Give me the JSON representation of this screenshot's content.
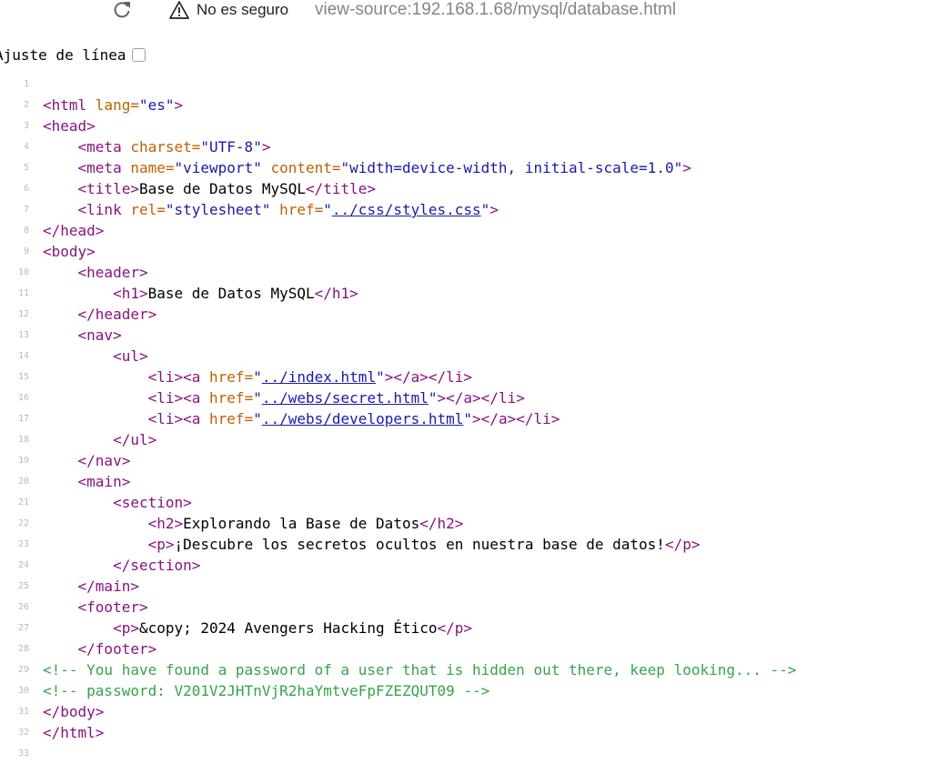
{
  "browser": {
    "security_text": "No es seguro",
    "url": "view-source:192.168.1.68/mysql/database.html"
  },
  "wrap_label": "Ajuste de línea",
  "lines": [
    [],
    [
      [
        "t",
        "<html "
      ],
      [
        "a",
        "lang="
      ],
      [
        "v",
        "\"es\""
      ],
      [
        "t",
        ">"
      ]
    ],
    [
      [
        "t",
        "<head>"
      ]
    ],
    [
      [
        "p",
        "    "
      ],
      [
        "t",
        "<meta "
      ],
      [
        "a",
        "charset="
      ],
      [
        "v",
        "\"UTF-8\""
      ],
      [
        "t",
        ">"
      ]
    ],
    [
      [
        "p",
        "    "
      ],
      [
        "t",
        "<meta "
      ],
      [
        "a",
        "name="
      ],
      [
        "v",
        "\"viewport\" "
      ],
      [
        "a",
        "content="
      ],
      [
        "v",
        "\"width=device-width, initial-scale=1.0\""
      ],
      [
        "t",
        ">"
      ]
    ],
    [
      [
        "p",
        "    "
      ],
      [
        "t",
        "<title>"
      ],
      [
        "p",
        "Base de Datos MySQL"
      ],
      [
        "t",
        "</title>"
      ]
    ],
    [
      [
        "p",
        "    "
      ],
      [
        "t",
        "<link "
      ],
      [
        "a",
        "rel="
      ],
      [
        "v",
        "\"stylesheet\" "
      ],
      [
        "a",
        "href="
      ],
      [
        "v",
        "\""
      ],
      [
        "lk",
        "../css/styles.css"
      ],
      [
        "v",
        "\""
      ],
      [
        "t",
        ">"
      ]
    ],
    [
      [
        "t",
        "</head>"
      ]
    ],
    [
      [
        "t",
        "<body>"
      ]
    ],
    [
      [
        "p",
        "    "
      ],
      [
        "t",
        "<header>"
      ]
    ],
    [
      [
        "p",
        "        "
      ],
      [
        "t",
        "<h1>"
      ],
      [
        "p",
        "Base de Datos MySQL"
      ],
      [
        "t",
        "</h1>"
      ]
    ],
    [
      [
        "p",
        "    "
      ],
      [
        "t",
        "</header>"
      ]
    ],
    [
      [
        "p",
        "    "
      ],
      [
        "t",
        "<nav>"
      ]
    ],
    [
      [
        "p",
        "        "
      ],
      [
        "t",
        "<ul>"
      ]
    ],
    [
      [
        "p",
        "            "
      ],
      [
        "t",
        "<li><a "
      ],
      [
        "a",
        "href="
      ],
      [
        "v",
        "\""
      ],
      [
        "lk",
        "../index.html"
      ],
      [
        "v",
        "\""
      ],
      [
        "t",
        "></a></li>"
      ]
    ],
    [
      [
        "p",
        "            "
      ],
      [
        "t",
        "<li><a "
      ],
      [
        "a",
        "href="
      ],
      [
        "v",
        "\""
      ],
      [
        "lk",
        "../webs/secret.html"
      ],
      [
        "v",
        "\""
      ],
      [
        "t",
        "></a></li>"
      ]
    ],
    [
      [
        "p",
        "            "
      ],
      [
        "t",
        "<li><a "
      ],
      [
        "a",
        "href="
      ],
      [
        "v",
        "\""
      ],
      [
        "lk",
        "../webs/developers.html"
      ],
      [
        "v",
        "\""
      ],
      [
        "t",
        "></a></li>"
      ]
    ],
    [
      [
        "p",
        "        "
      ],
      [
        "t",
        "</ul>"
      ]
    ],
    [
      [
        "p",
        "    "
      ],
      [
        "t",
        "</nav>"
      ]
    ],
    [
      [
        "p",
        "    "
      ],
      [
        "t",
        "<main>"
      ]
    ],
    [
      [
        "p",
        "        "
      ],
      [
        "t",
        "<section>"
      ]
    ],
    [
      [
        "p",
        "            "
      ],
      [
        "t",
        "<h2>"
      ],
      [
        "p",
        "Explorando la Base de Datos"
      ],
      [
        "t",
        "</h2>"
      ]
    ],
    [
      [
        "p",
        "            "
      ],
      [
        "t",
        "<p>"
      ],
      [
        "p",
        "¡Descubre los secretos ocultos en nuestra base de datos!"
      ],
      [
        "t",
        "</p>"
      ]
    ],
    [
      [
        "p",
        "        "
      ],
      [
        "t",
        "</section>"
      ]
    ],
    [
      [
        "p",
        "    "
      ],
      [
        "t",
        "</main>"
      ]
    ],
    [
      [
        "p",
        "    "
      ],
      [
        "t",
        "<footer>"
      ]
    ],
    [
      [
        "p",
        "        "
      ],
      [
        "t",
        "<p>"
      ],
      [
        "p",
        "&copy; 2024 Avengers Hacking Ético"
      ],
      [
        "t",
        "</p>"
      ]
    ],
    [
      [
        "p",
        "    "
      ],
      [
        "t",
        "</footer>"
      ]
    ],
    [
      [
        "c",
        "<!-- You have found a password of a user that is hidden out there, keep looking... -->"
      ]
    ],
    [
      [
        "c",
        "<!-- password: V201V2JHTnVjR2haYmtveFpFZEZQUT09 -->"
      ]
    ],
    [
      [
        "t",
        "</body>"
      ]
    ],
    [
      [
        "t",
        "</html>"
      ]
    ],
    []
  ]
}
